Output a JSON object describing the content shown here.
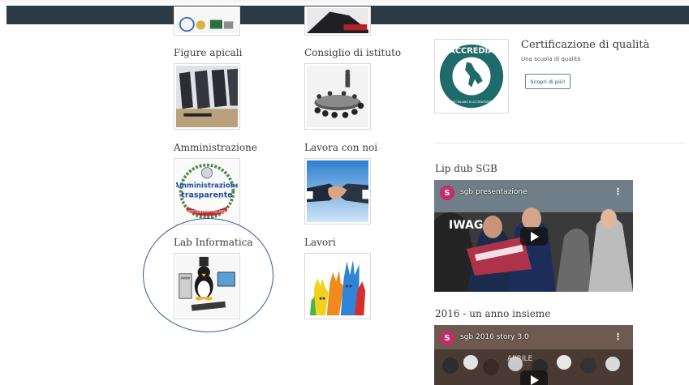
{
  "tiles": {
    "figure_apicali": "Figure apicali",
    "consiglio": "Consiglio di istituto",
    "amministrazione": "Amministrazione",
    "lavora": "Lavora con noi",
    "lab": "Lab Informatica",
    "lavori": "Lavori"
  },
  "amministrazione_logo": {
    "line1": "Amministrazione",
    "line2": "trasparente",
    "ribbon": "REPUBBLICA ITALIANA"
  },
  "certification": {
    "title": "Certificazione di qualità",
    "subtitle": "Una scuola di qualità",
    "button": "Scopri di più!",
    "logo_text": "ACCREDIA",
    "logo_subtext": "L'ENTE ITALIANO DI ACCREDITAMENTO"
  },
  "videos": [
    {
      "section": "Lip dub SGB",
      "avatar": "S",
      "title": "sgb presentazione",
      "menu": "⋮"
    },
    {
      "section": "2016 - un anno insieme",
      "avatar": "S",
      "title": "sgb 2016 story 3.0",
      "menu": "⋮",
      "overlay_text": "APRILE"
    }
  ],
  "colors": {
    "topbar": "#2b3a44",
    "highlight_circle": "#3a5a8e",
    "accredia": "#1f6b6b",
    "avatar": "#c62a6a"
  }
}
